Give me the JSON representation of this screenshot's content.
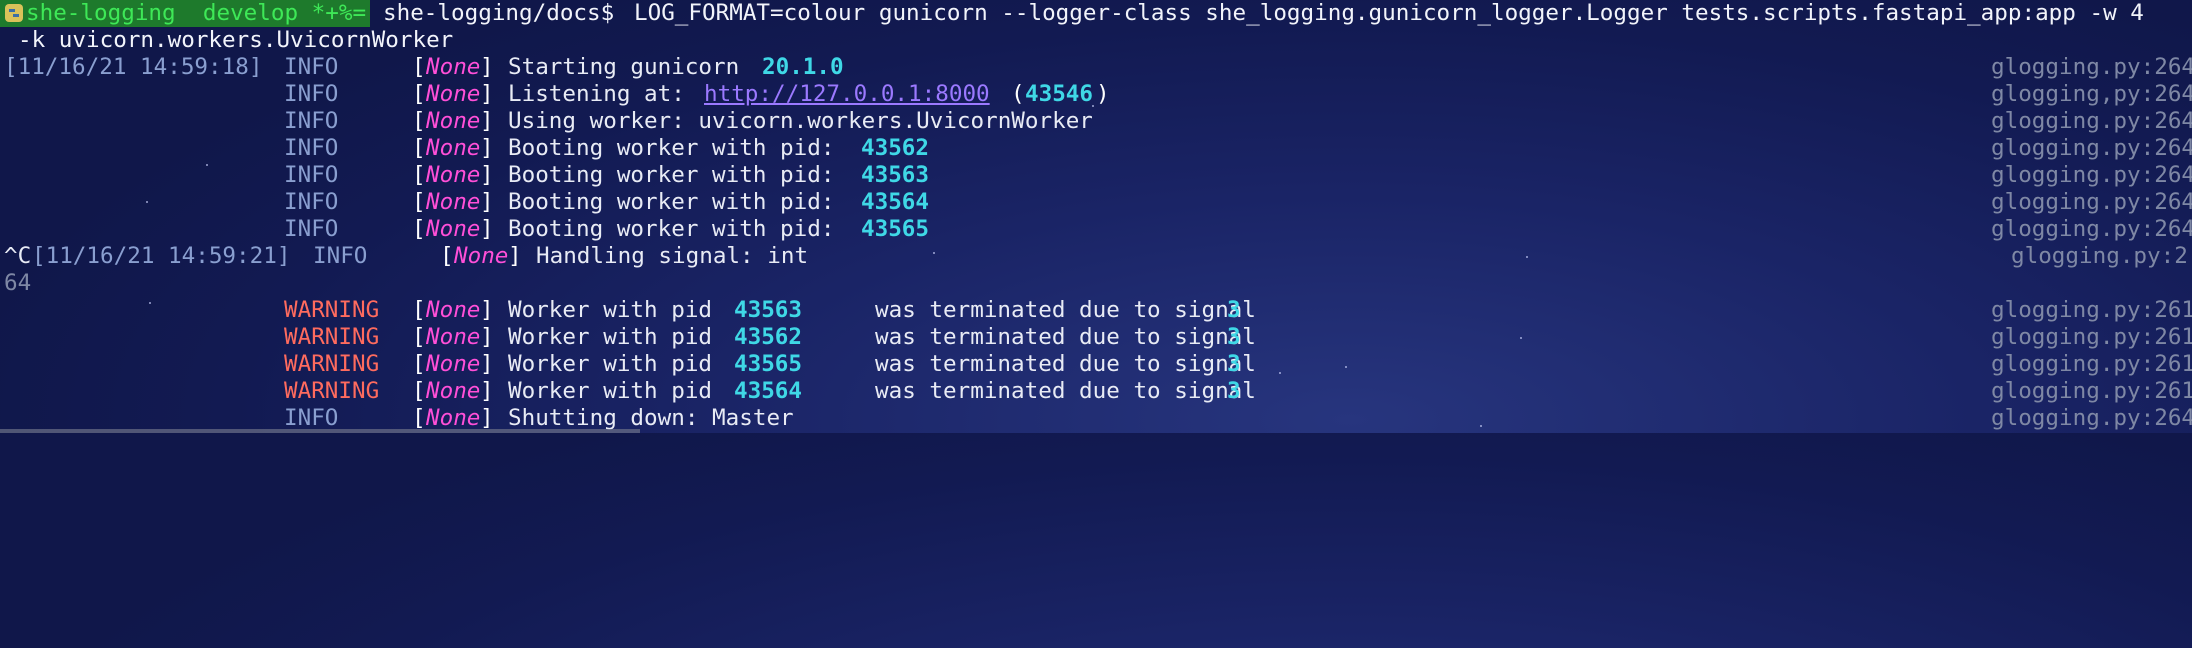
{
  "prompt": {
    "env_label": "she-logging",
    "branch_label": "develop *+%=",
    "cwd": "she-logging/docs$",
    "command_line1": "LOG_FORMAT=colour gunicorn --logger-class she_logging.gunicorn_logger.Logger tests.scripts.fastapi_app:app -w 4",
    "command_line2": "-k uvicorn.workers.UvicornWorker"
  },
  "log": {
    "timestamp1": "[11/16/21 14:59:18]",
    "timestamp2": "[11/16/21 14:59:21]",
    "ctrl_c": "^C",
    "none": "None",
    "lb": "[",
    "rb": "]",
    "info": "INFO",
    "warning": "WARNING",
    "starting": "Starting gunicorn",
    "version": "20.1.0",
    "listening": "Listening at:",
    "url": "http://127.0.0.1:8000",
    "listen_pid": "43546",
    "using_worker": "Using worker: uvicorn.workers.UvicornWorker",
    "booting": "Booting worker with pid:",
    "pids": [
      "43562",
      "43563",
      "43564",
      "43565"
    ],
    "handling": "Handling signal: int",
    "wrap_tail": "64",
    "worker_with_pid": "Worker with pid",
    "terminated": "was terminated due to signal",
    "signal": "3",
    "term_pids": [
      "43563",
      "43562",
      "43565",
      "43564"
    ],
    "shutting_down": "Shutting down: Master"
  },
  "filerefs": {
    "f264": "glogging.py:264",
    "f264_comma": "glogging,py:264",
    "f2": "glogging.py:2",
    "f261": "glogging.py:261"
  }
}
